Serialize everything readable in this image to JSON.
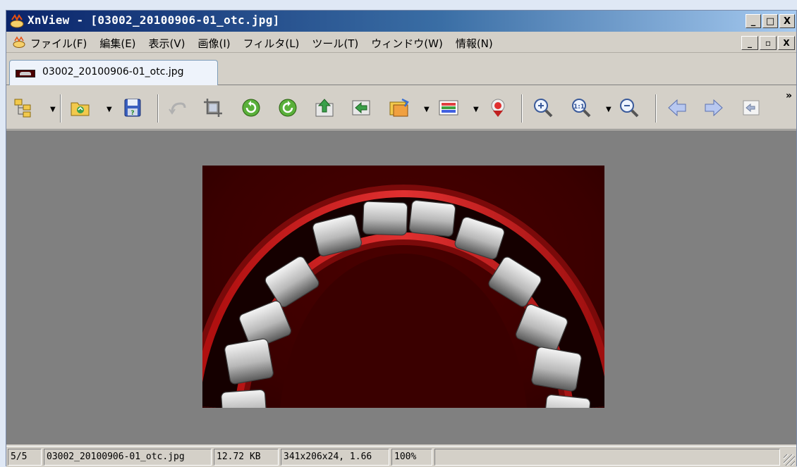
{
  "window": {
    "title": "XnView - [03002_20100906-01_otc.jpg]",
    "controls": {
      "minimize": "_",
      "maximize": "□",
      "close": "X"
    },
    "mdi_controls": {
      "minimize": "_",
      "restore": "▫",
      "close": "X"
    }
  },
  "menu": {
    "items": [
      "ファイル(F)",
      "編集(E)",
      "表示(V)",
      "画像(I)",
      "フィルタ(L)",
      "ツール(T)",
      "ウィンドウ(W)",
      "情報(N)"
    ]
  },
  "tabs": [
    {
      "label": "03002_20100906-01_otc.jpg",
      "active": true
    }
  ],
  "toolbar": {
    "buttons": [
      "browser-tree-icon",
      "open-folder-icon",
      "save-icon",
      "undo-icon",
      "crop-icon",
      "rotate-left-icon",
      "rotate-right-icon",
      "export-icon",
      "convert-icon",
      "batch-icon",
      "adjust-colors-icon",
      "red-eye-icon",
      "zoom-in-icon",
      "zoom-actual-icon",
      "zoom-out-icon",
      "previous-icon",
      "next-icon",
      "back-icon"
    ],
    "overflow": "»"
  },
  "status": {
    "position": "5/5",
    "filename": "03002_20100906-01_otc.jpg",
    "filesize": "12.72 KB",
    "dimensions": "341x206x24, 1.66",
    "zoom": "100%"
  },
  "colors": {
    "title_start": "#0a246a",
    "title_end": "#a6caf0",
    "chrome": "#d4d0c8",
    "viewer_bg": "#808080",
    "image_bg": "#3a0000"
  }
}
